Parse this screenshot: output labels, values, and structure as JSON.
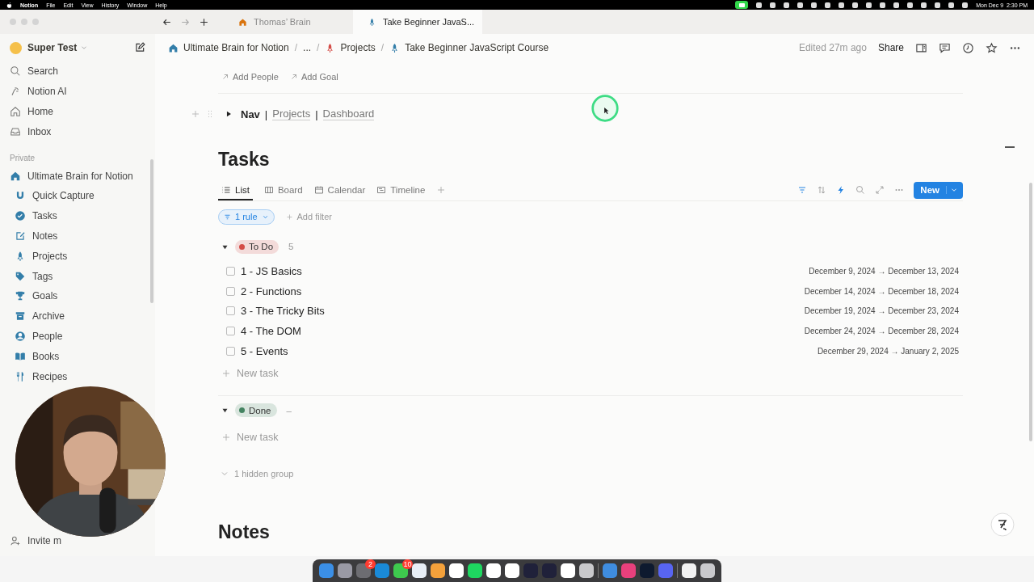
{
  "menu_bar": {
    "app": "Notion",
    "menus": [
      "File",
      "Edit",
      "View",
      "History",
      "Window",
      "Help"
    ],
    "clock": "Mon Dec 9  2:30 PM"
  },
  "tabs": [
    {
      "label": "Thomas’ Brain",
      "selected": false
    },
    {
      "label": "Take Beginner JavaS...",
      "selected": true
    }
  ],
  "workspace": "Super Test",
  "sidebar": {
    "items": [
      "Search",
      "Notion AI",
      "Home",
      "Inbox"
    ],
    "section": "Private",
    "pages": [
      {
        "label": "Ultimate Brain for Notion",
        "children": [
          {
            "label": "Quick Capture"
          },
          {
            "label": "Tasks"
          },
          {
            "label": "Notes"
          },
          {
            "label": "Projects"
          },
          {
            "label": "Tags"
          },
          {
            "label": "Goals"
          },
          {
            "label": "Archive"
          },
          {
            "label": "People"
          },
          {
            "label": "Books"
          },
          {
            "label": "Recipes"
          }
        ]
      }
    ],
    "invite": "Invite m"
  },
  "breadcrumb": {
    "separator": "/",
    "items": [
      "Ultimate Brain for Notion",
      "...",
      "Projects",
      "Take Beginner JavaScript Course"
    ]
  },
  "edited": "Edited 27m ago",
  "share": "Share",
  "properties": [
    "Add People",
    "Add Goal"
  ],
  "nav": {
    "title": "Nav",
    "separator": "|",
    "links": [
      "Projects",
      "Dashboard"
    ],
    "expanded": false
  },
  "tasks_db": {
    "title": "Tasks",
    "views": [
      {
        "label": "List",
        "selected": true
      },
      {
        "label": "Board",
        "selected": false
      },
      {
        "label": "Calendar",
        "selected": false
      },
      {
        "label": "Timeline",
        "selected": false
      }
    ],
    "new_button": "New",
    "filter": "1 rule",
    "add_filter": "Add filter",
    "groups": [
      {
        "label": "To Do",
        "color": "#d44c47",
        "count": "5",
        "expanded": true,
        "new_task": "New task",
        "tasks": [
          {
            "title": "1 - JS Basics",
            "dates": "December 9, 2024 → December 13, 2024",
            "checked": false
          },
          {
            "title": "2 - Functions",
            "dates": "December 14, 2024 → December 18, 2024",
            "checked": false
          },
          {
            "title": "3 - The Tricky Bits",
            "dates": "December 19, 2024 → December 23, 2024",
            "checked": false
          },
          {
            "title": "4 - The DOM",
            "dates": "December 24, 2024 → December 28, 2024",
            "checked": false
          },
          {
            "title": "5 - Events",
            "dates": "December 29, 2024 → January 2, 2025",
            "checked": false
          }
        ]
      },
      {
        "label": "Done",
        "color": "#448361",
        "count": "–",
        "expanded": true,
        "new_task": "New task"
      }
    ],
    "hidden_groups": "1 hidden group"
  },
  "notes_heading": "Notes",
  "dock": {
    "badges": [
      "2",
      "10"
    ]
  }
}
